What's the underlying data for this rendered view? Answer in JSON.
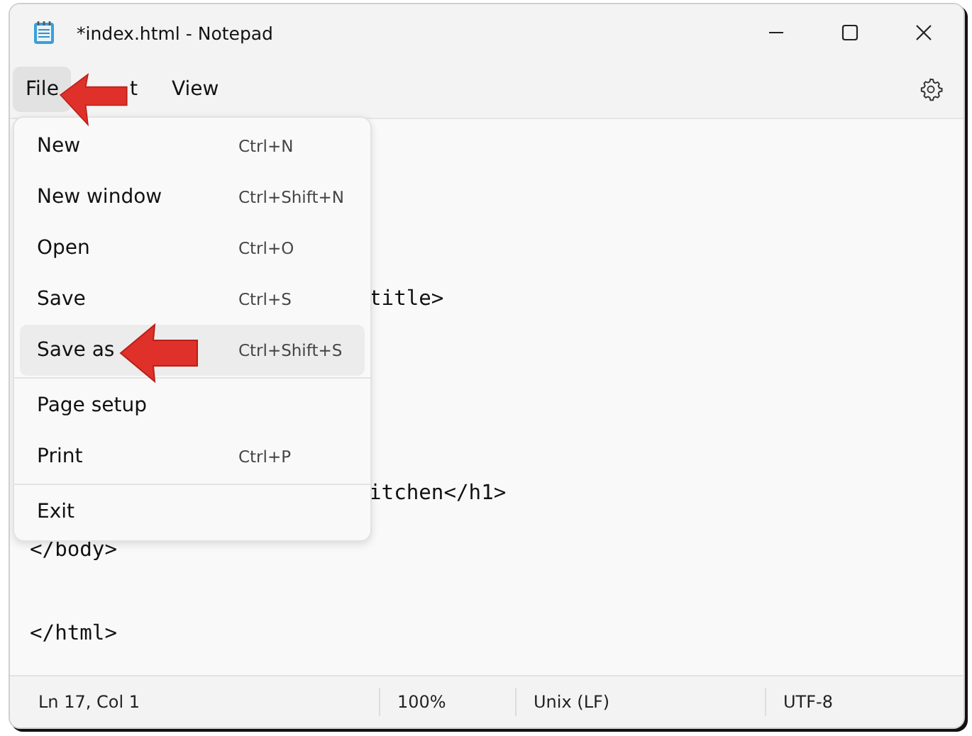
{
  "window": {
    "title": "*index.html - Notepad"
  },
  "menu_bar": [
    {
      "label": "File",
      "selected": true
    },
    {
      "label": "t",
      "selected": false
    },
    {
      "label": "View",
      "selected": false
    }
  ],
  "file_menu": {
    "groups": [
      [
        {
          "label": "New",
          "shortcut": "Ctrl+N",
          "selected": false
        },
        {
          "label": "New window",
          "shortcut": "Ctrl+Shift+N",
          "selected": false
        },
        {
          "label": "Open",
          "shortcut": "Ctrl+O",
          "selected": false
        },
        {
          "label": "Save",
          "shortcut": "Ctrl+S",
          "selected": false
        },
        {
          "label": "Save as",
          "shortcut": "Ctrl+Shift+S",
          "selected": true
        }
      ],
      [
        {
          "label": "Page setup",
          "selected": false
        },
        {
          "label": "Print",
          "shortcut": "Ctrl+P",
          "selected": false
        }
      ],
      [
        {
          "label": "Exit",
          "selected": false
        }
      ]
    ]
  },
  "editor": {
    "lines": [
      {
        "text": "title>",
        "kind": "partial"
      },
      {
        "text": "itchen</h1>",
        "kind": "partial"
      },
      {
        "text": "</body>",
        "kind": "full"
      },
      {
        "text": "</html>",
        "kind": "full"
      }
    ]
  },
  "status_bar": [
    "Ln 17, Col 1",
    "100%",
    "Unix (LF)",
    "UTF-8"
  ]
}
